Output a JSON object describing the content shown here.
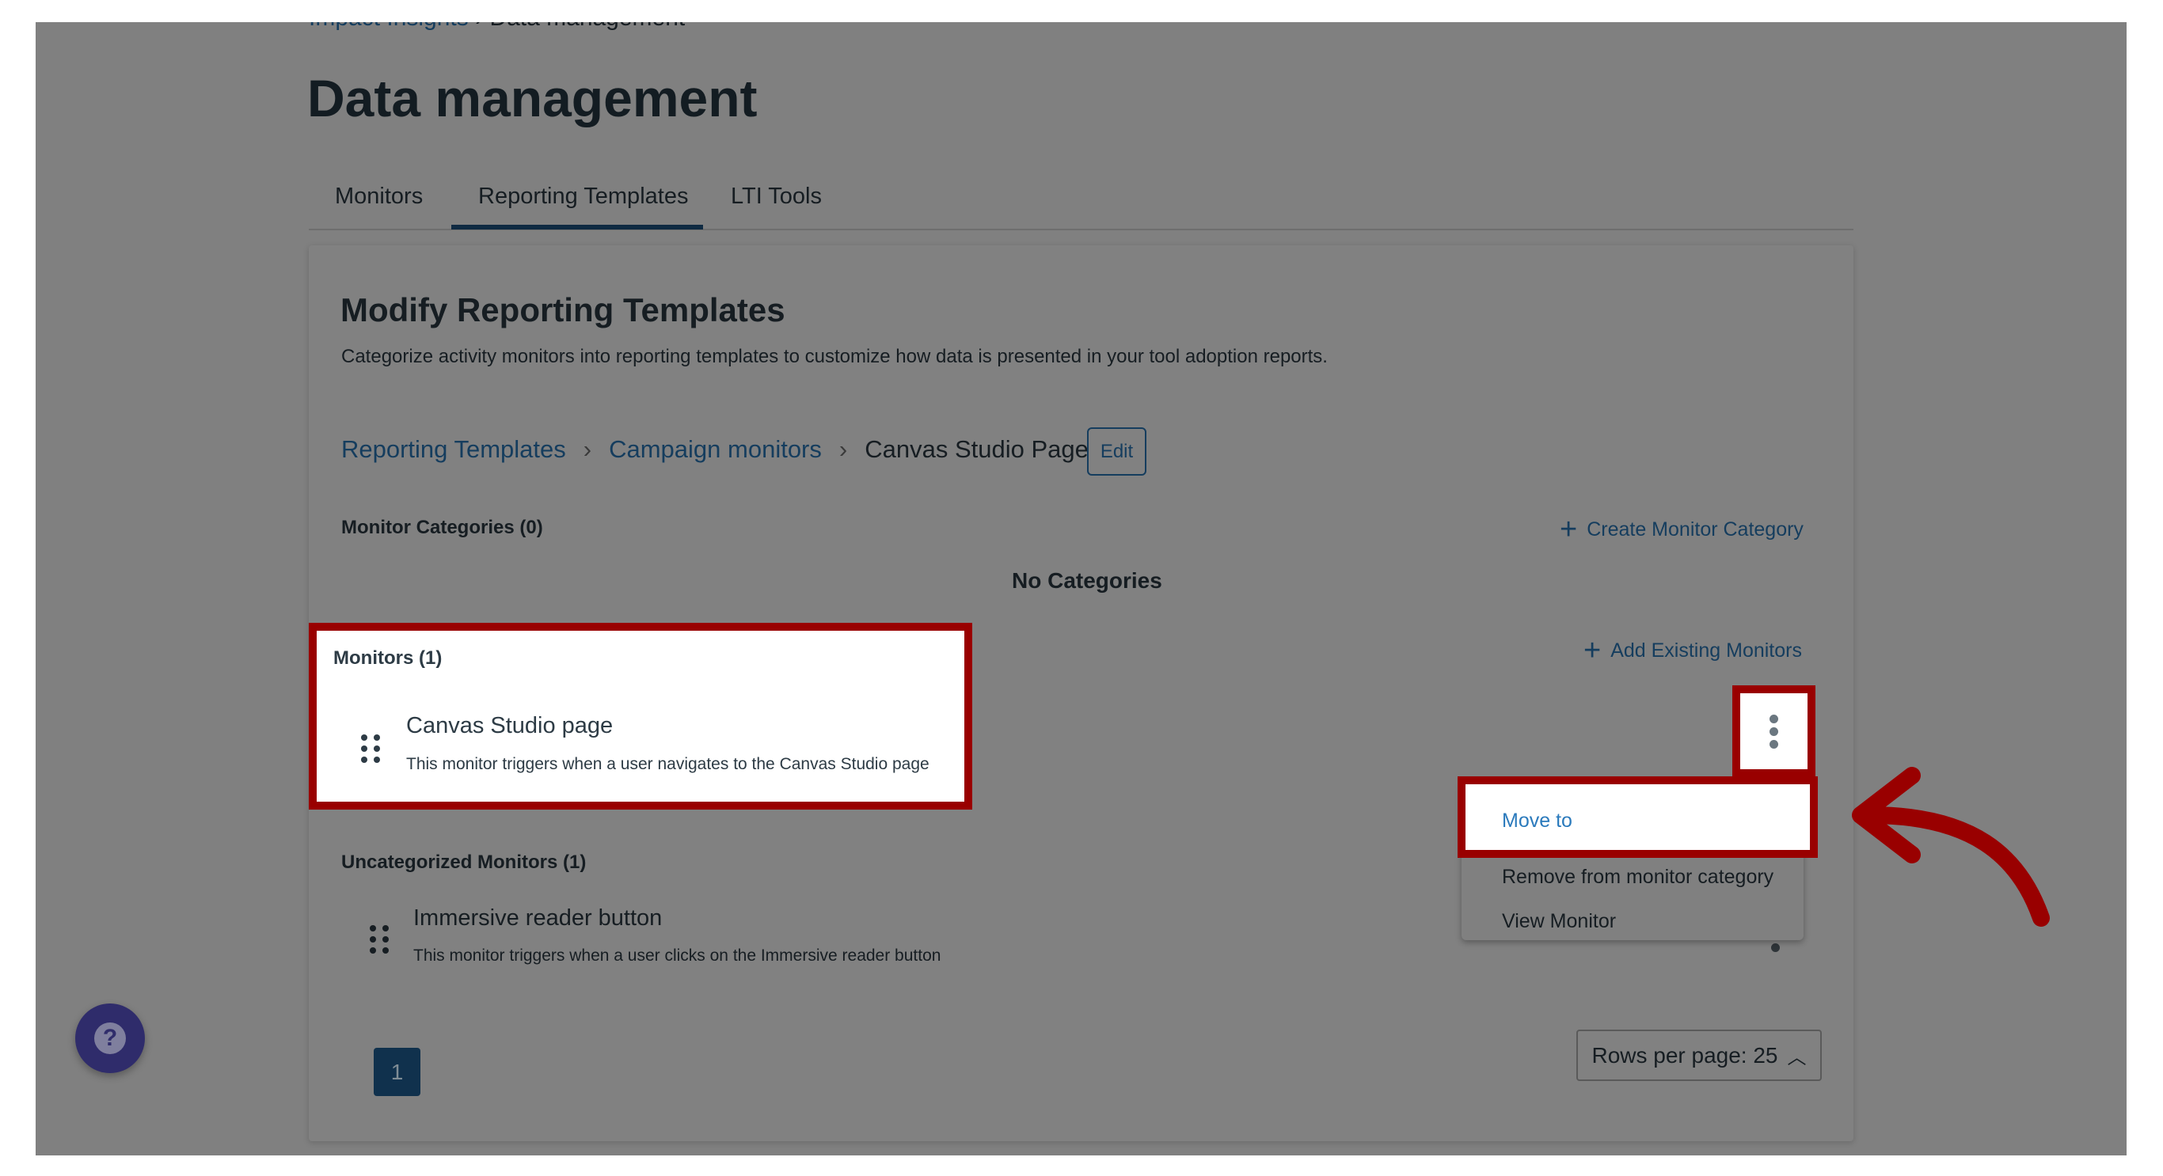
{
  "breadcrumb": {
    "items": [
      "Impact Insights",
      "Data management"
    ]
  },
  "page_title": "Data management",
  "tabs": [
    {
      "label": "Monitors"
    },
    {
      "label": "Reporting Templates",
      "active": true
    },
    {
      "label": "LTI Tools"
    }
  ],
  "section": {
    "title": "Modify Reporting Templates",
    "description": "Categorize activity monitors into reporting templates to customize how data is presented in your tool adoption reports."
  },
  "template_breadcrumb": {
    "items": [
      "Reporting Templates",
      "Campaign monitors",
      "Canvas Studio Page"
    ],
    "edit_label": "Edit"
  },
  "categories": {
    "label": "Monitor Categories (0)",
    "create_label": "Create Monitor Category",
    "empty": "No Categories"
  },
  "monitors": {
    "label": "Monitors (1)",
    "add_label": "Add Existing Monitors",
    "items": [
      {
        "name": "Canvas Studio page",
        "description": "This monitor triggers when a user navigates to the Canvas Studio page"
      }
    ]
  },
  "uncategorized": {
    "label": "Uncategorized Monitors (1)",
    "items": [
      {
        "name": "Immersive reader button",
        "description": "This monitor triggers when a user clicks on the Immersive reader button"
      }
    ]
  },
  "menu": {
    "items": [
      "Move to",
      "Remove from monitor category",
      "View Monitor"
    ]
  },
  "pagination": {
    "current": "1",
    "rows_per_page": "Rows per page: 25"
  },
  "colors": {
    "highlight": "#990000",
    "link": "#2b7abc",
    "tab_active": "#1d4f7c"
  }
}
